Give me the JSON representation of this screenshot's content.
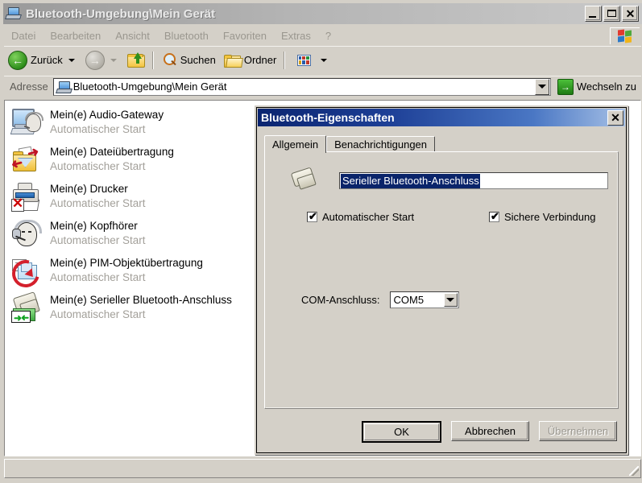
{
  "window": {
    "title": "Bluetooth-Umgebung\\Mein Gerät",
    "title_icon": "computer-icon",
    "minimize_label": "_",
    "maximize_label": "□",
    "close_label": "✕"
  },
  "menubar": {
    "items": [
      {
        "label": "Datei"
      },
      {
        "label": "Bearbeiten"
      },
      {
        "label": "Ansicht"
      },
      {
        "label": "Bluetooth"
      },
      {
        "label": "Favoriten"
      },
      {
        "label": "Extras"
      },
      {
        "label": "?"
      }
    ],
    "logo_icon": "windows-logo-icon"
  },
  "toolbar": {
    "back_label": "Zurück",
    "back_icon": "back-arrow-icon",
    "forward_icon": "forward-arrow-icon",
    "up_icon": "up-folder-icon",
    "search_label": "Suchen",
    "search_icon": "magnifier-icon",
    "folders_label": "Ordner",
    "folders_icon": "folder-icon",
    "views_icon": "views-grid-icon"
  },
  "address": {
    "label": "Adresse",
    "value": "Bluetooth-Umgebung\\Mein Gerät",
    "icon": "computer-icon",
    "dropdown_icon": "chevron-down-icon",
    "go_label": "Wechseln zu",
    "go_icon": "green-arrow-icon"
  },
  "list": {
    "items": [
      {
        "name": "Mein(e) Audio-Gateway",
        "status": "Automatischer Start",
        "icon": "audio-gateway-icon"
      },
      {
        "name": "Mein(e) Dateiübertragung",
        "status": "Automatischer Start",
        "icon": "file-transfer-icon"
      },
      {
        "name": "Mein(e) Drucker",
        "status": "Automatischer Start",
        "icon": "printer-icon"
      },
      {
        "name": "Mein(e) Kopfhörer",
        "status": "Automatischer Start",
        "icon": "headset-icon"
      },
      {
        "name": "Mein(e) PIM-Objektübertragung",
        "status": "Automatischer Start",
        "icon": "pim-transfer-icon"
      },
      {
        "name": "Mein(e) Serieller Bluetooth-Anschluss",
        "status": "Automatischer Start",
        "icon": "serial-port-icon"
      }
    ]
  },
  "statusbar": {
    "text": ""
  },
  "dialog": {
    "title": "Bluetooth-Eigenschaften",
    "close_label": "✕",
    "tabs": [
      {
        "label": "Allgemein",
        "active": true
      },
      {
        "label": "Benachrichtigungen",
        "active": false
      }
    ],
    "service_icon": "serial-port-icon",
    "name_field": {
      "value": "Serieller Bluetooth-Anschluss",
      "selected": true
    },
    "checkboxes": [
      {
        "label": "Automatischer Start",
        "checked": true,
        "mark": "✔"
      },
      {
        "label": "Sichere Verbindung",
        "checked": true,
        "mark": "✔"
      }
    ],
    "com_port": {
      "label": "COM-Anschluss:",
      "value": "COM5",
      "dropdown_icon": "chevron-down-icon"
    },
    "buttons": {
      "ok": "OK",
      "cancel": "Abbrechen",
      "apply": "Übernehmen"
    }
  },
  "colors": {
    "face": "#d4d0c8",
    "dialog_title_start": "#0a2470",
    "dialog_title_end": "#a7c1e6",
    "selection": "#0a246a",
    "disabled_text": "#9a978f"
  }
}
